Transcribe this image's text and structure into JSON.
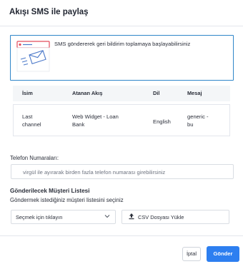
{
  "modal": {
    "title": "Akışı SMS ile paylaş"
  },
  "info": {
    "text": "SMS göndererek geri bildirim toplamaya başlayabilirsiniz",
    "illustration_icon": "browser-envelope-icon"
  },
  "table": {
    "headers": [
      "İsim",
      "Atanan Akış",
      "Dil",
      "Mesaj"
    ],
    "rows": [
      {
        "name_line1": "Last",
        "name_line2": "channel",
        "flow_line1": "Web Widget - Loan",
        "flow_line2": "Bank",
        "language": "English",
        "message_line1": "generic -",
        "message_line2": "bu"
      }
    ]
  },
  "phone": {
    "label": "Telefon Numaraları:",
    "placeholder": "virgül ile ayırarak birden fazla telefon numarası girebilirsiniz"
  },
  "recipients": {
    "title": "Gönderilecek Müşteri Listesi",
    "subtitle": "Göndermek istediğiniz müşteri listesini seçiniz",
    "select_value": "Seçmek için tıklayın",
    "csv_label": "CSV Dosyası Yükle"
  },
  "footer": {
    "cancel_label": "İptal",
    "send_label": "Gönder"
  },
  "colors": {
    "accent": "#2d7ff0",
    "info_border": "#2f86c9"
  }
}
